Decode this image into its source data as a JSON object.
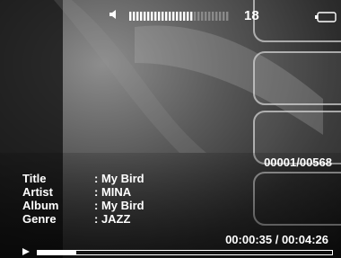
{
  "status_bar": {
    "volume_icon": "speaker-icon",
    "volume_level": 0.65,
    "volume_value": "18",
    "battery_icon": "battery-icon"
  },
  "track": {
    "counter": "00001/00568",
    "fields": [
      {
        "label": "Title",
        "value": ": My Bird"
      },
      {
        "label": "Artist",
        "value": ": MINA"
      },
      {
        "label": "Album",
        "value": ": My Bird"
      },
      {
        "label": "Genre",
        "value": ": JAZZ"
      }
    ]
  },
  "playback": {
    "state_icon": "play-icon",
    "time": "00:00:35 / 00:04:26",
    "progress": 0.131
  },
  "colors": {
    "text": "#ffffff",
    "background": "#2d2d2d"
  }
}
